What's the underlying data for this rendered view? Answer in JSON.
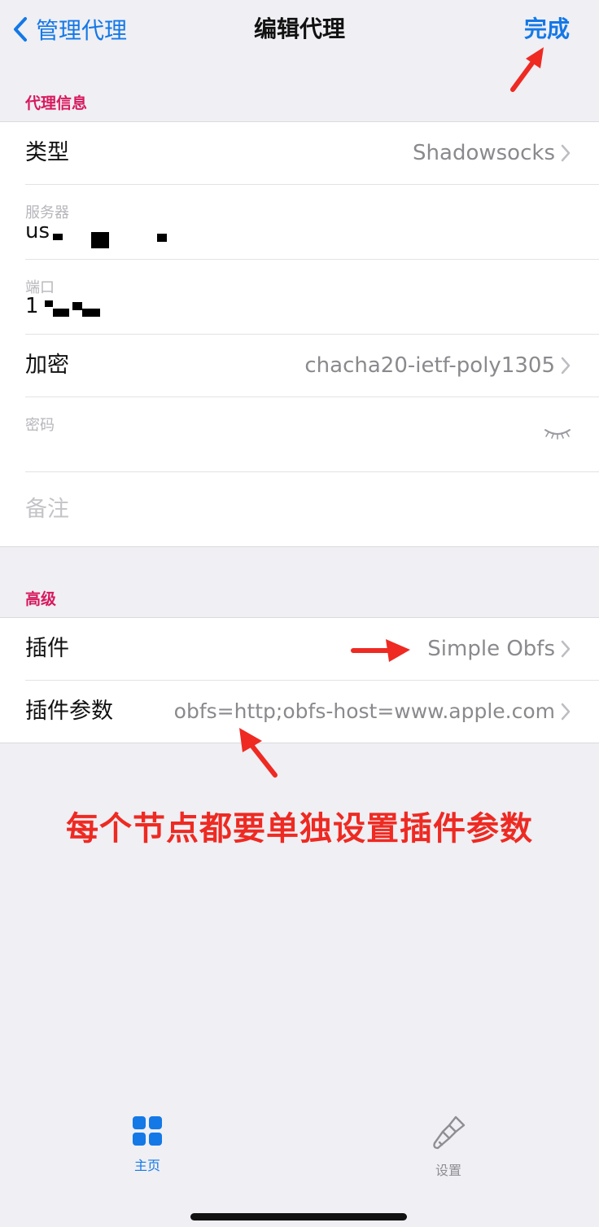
{
  "nav": {
    "back_label": "管理代理",
    "title": "编辑代理",
    "done_label": "完成"
  },
  "sections": {
    "proxy_info_header": "代理信息",
    "advanced_header": "高级"
  },
  "proxy_info": {
    "type_label": "类型",
    "type_value": "Shadowsocks",
    "server_label": "服务器",
    "server_value": "us",
    "port_label": "端口",
    "port_value": "1",
    "encryption_label": "加密",
    "encryption_value": "chacha20-ietf-poly1305",
    "password_label": "密码",
    "note_placeholder": "备注"
  },
  "advanced": {
    "plugin_label": "插件",
    "plugin_value": "Simple Obfs",
    "plugin_params_label": "插件参数",
    "plugin_params_value": "obfs=http;obfs-host=www.apple.com"
  },
  "annotation": {
    "text": "每个节点都要单独设置插件参数",
    "color": "#ee2a22"
  },
  "tabbar": {
    "home_label": "主页",
    "settings_label": "设置"
  },
  "colors": {
    "accent": "#1478e6",
    "section_header": "#d8195c",
    "background": "#efeff4"
  },
  "icons": {
    "back": "chevron-left-icon",
    "chevron": "chevron-right-icon",
    "eye": "eye-closed-icon",
    "home": "grid-icon",
    "settings": "paintbrush-icon"
  }
}
